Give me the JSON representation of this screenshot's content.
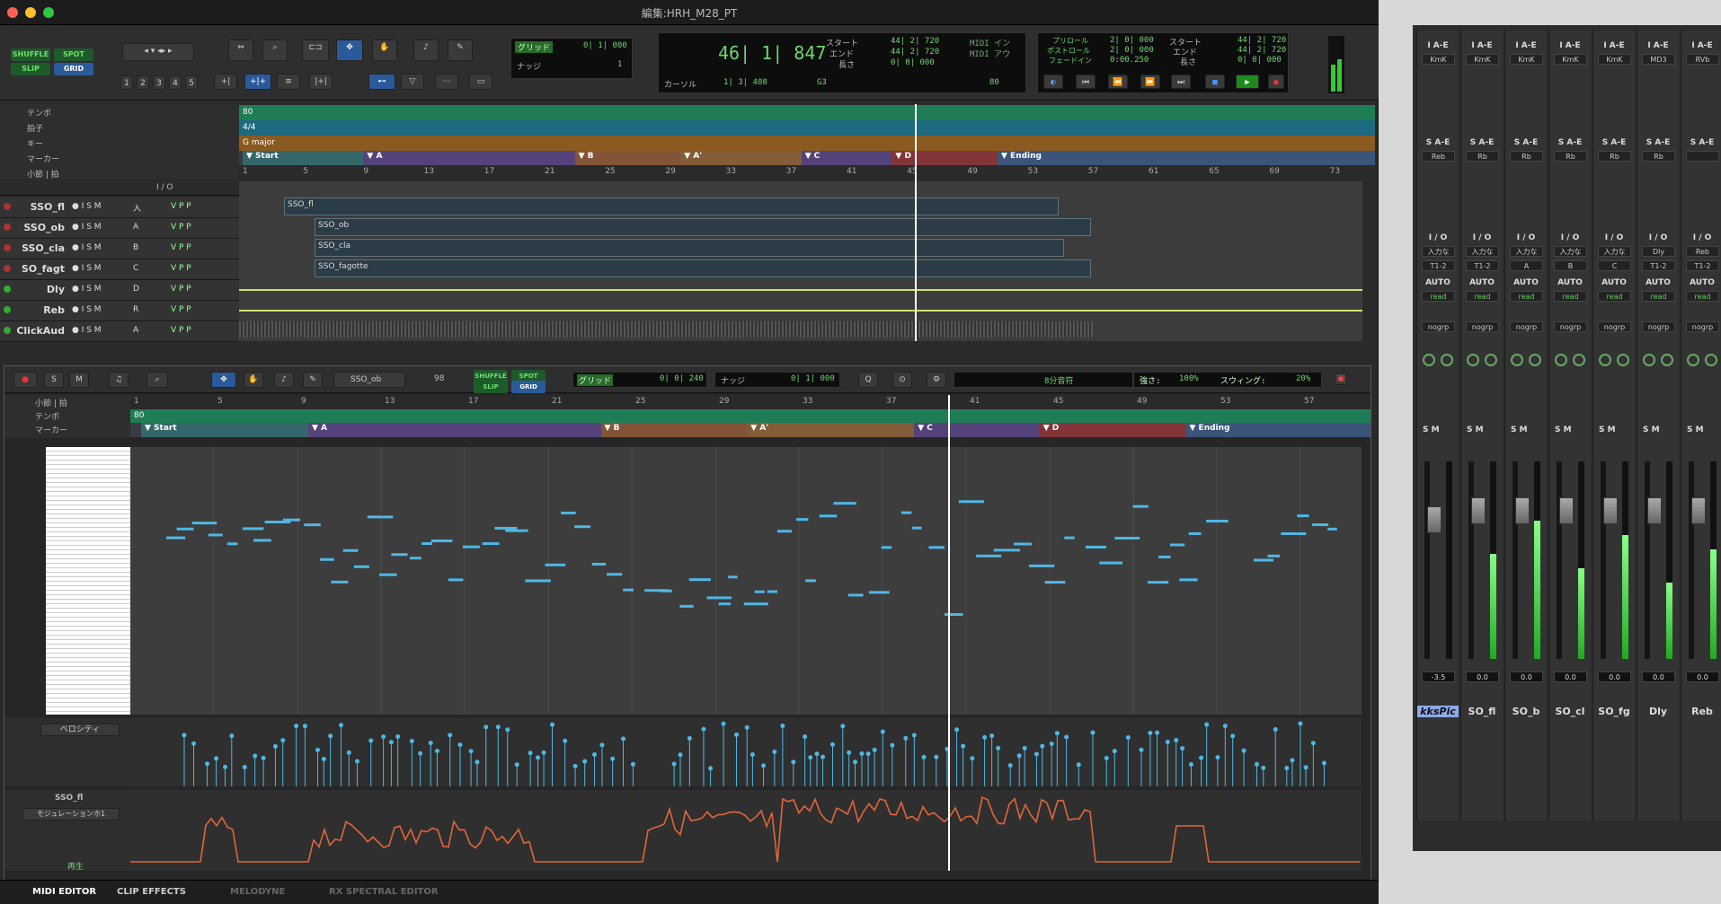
{
  "window_title": "編集:HRH_M28_PT",
  "colors": {
    "accent": "#2a5a9a",
    "green": "#6fd66f",
    "tempo": "#1f7d55",
    "meter": "#1d6a80",
    "key": "#8a5a20",
    "marker": "#5a4a8a",
    "clip": "#2b3c47",
    "note": "#4fb8e6",
    "automation": "#e0663a"
  },
  "toolbar": {
    "modes": [
      "SHUFFLE",
      "SPOT",
      "SLIP",
      "GRID"
    ],
    "zoom_presets": [
      "1",
      "2",
      "3",
      "4",
      "5"
    ],
    "grid": {
      "label": "グリッド",
      "value": "0| 1| 000"
    },
    "nudge": {
      "label": "ナッジ",
      "value": "1"
    },
    "main_counter": "46| 1| 847",
    "start_label": "スタート",
    "end_label": "エンド",
    "length_label": "長さ",
    "start": "44| 2| 720",
    "end": "44| 2| 720",
    "length": "0| 0| 000",
    "cursor_label": "カーソル",
    "cursor": "1| 3| 408",
    "pitch": "G3",
    "midi_in": "MIDI イン",
    "midi_out": "MIDI アウ",
    "tempo": "80",
    "preroll_label": "プリロール",
    "postroll_label": "ポストロール",
    "fadein_label": "フェードイン",
    "preroll": "2| 0| 000",
    "postroll": "2| 0| 000",
    "fadein": "0:00.250",
    "start2": "44| 2| 720",
    "end2": "44| 2| 720",
    "length2": "0| 0| 000"
  },
  "rulers": {
    "tempo": "テンポ",
    "meter": "拍子",
    "key": "キー",
    "markers": "マーカー",
    "bars": "小節 | 拍",
    "tempo_value": "80",
    "meter_value": "4/4",
    "key_value": "G major"
  },
  "bar_numbers": [
    "1",
    "5",
    "9",
    "13",
    "17",
    "21",
    "25",
    "29",
    "33",
    "37",
    "41",
    "45",
    "49",
    "53",
    "57",
    "61",
    "65",
    "69",
    "73"
  ],
  "markers": [
    {
      "name": "Start",
      "bar": 1
    },
    {
      "name": "A",
      "bar": 9
    },
    {
      "name": "B",
      "bar": 23
    },
    {
      "name": "A'",
      "bar": 30
    },
    {
      "name": "C",
      "bar": 38
    },
    {
      "name": "D",
      "bar": 44
    },
    {
      "name": "Ending",
      "bar": 51
    }
  ],
  "io_label": "I / O",
  "tracks": [
    {
      "name": "SSO_fl",
      "io": "入",
      "clip": "SSO_fl"
    },
    {
      "name": "SSO_ob",
      "io": "A",
      "clip": "SSO_ob"
    },
    {
      "name": "SSO_cla",
      "io": "B",
      "clip": "SSO_cla"
    },
    {
      "name": "SO_fagt",
      "io": "C",
      "clip": "SSO_fagotte"
    },
    {
      "name": "Dly",
      "io": "D",
      "clip": ""
    },
    {
      "name": "Reb",
      "io": "R",
      "clip": ""
    },
    {
      "name": "ClickAud",
      "io": "A",
      "clip": ""
    }
  ],
  "midi_editor": {
    "track": "SSO_ob",
    "velocity_value": "98",
    "grid_label": "グリッド",
    "grid": "0| 0| 240",
    "nudge_label": "ナッジ",
    "nudge": "0| 1| 000",
    "note_value": "8分音符",
    "strength_label": "強さ:",
    "strength": "100%",
    "swing_label": "スウィング:",
    "swing": "20%",
    "bars": [
      "1",
      "5",
      "9",
      "13",
      "17",
      "21",
      "25",
      "29",
      "33",
      "37",
      "41",
      "45",
      "49",
      "53",
      "57"
    ],
    "velocity_lane": "ベロシティ",
    "cc_track": "SSO_fl",
    "cc_lane": "モジュレーションホ1",
    "play_label": "再生"
  },
  "bottom_tabs": [
    "MIDI EDITOR",
    "CLIP EFFECTS",
    "MELODYNE",
    "RX SPECTRAL EDITOR"
  ],
  "mixer": {
    "strips": [
      {
        "insert": "KmK",
        "send": "Reb",
        "io": "入力な",
        "io2": "T1-2",
        "auto": "AUTO",
        "read": "read",
        "group": "nogrp",
        "vol": "-3.5",
        "name": "kksPic"
      },
      {
        "insert": "KmK",
        "send": "Rb",
        "io": "入力な",
        "io2": "T1-2",
        "auto": "AUTO",
        "read": "read",
        "group": "nogrp",
        "vol": "0.0",
        "name": "SO_fl"
      },
      {
        "insert": "KmK",
        "send": "Rb",
        "io": "入力な",
        "io2": "A",
        "auto": "AUTO",
        "read": "read",
        "group": "nogrp",
        "vol": "0.0",
        "name": "SO_b"
      },
      {
        "insert": "KmK",
        "send": "Rb",
        "io": "入力な",
        "io2": "B",
        "auto": "AUTO",
        "read": "read",
        "group": "nogrp",
        "vol": "0.0",
        "name": "SO_cl"
      },
      {
        "insert": "KmK",
        "send": "Rb",
        "io": "入力な",
        "io2": "C",
        "auto": "AUTO",
        "read": "read",
        "group": "nogrp",
        "vol": "0.0",
        "name": "SO_fg"
      },
      {
        "insert": "MD3",
        "send": "Rb",
        "io": "Dly",
        "io2": "T1-2",
        "auto": "AUTO",
        "read": "read",
        "group": "nogrp",
        "vol": "0.0",
        "name": "Dly"
      },
      {
        "insert": "RVb",
        "send": "",
        "io": "Reb",
        "io2": "T1-2",
        "auto": "AUTO",
        "read": "read",
        "group": "nogrp",
        "vol": "0.0",
        "name": "Reb"
      }
    ],
    "insert_header": "I A-E",
    "send_header": "S A-E",
    "io_header": "I / O"
  }
}
